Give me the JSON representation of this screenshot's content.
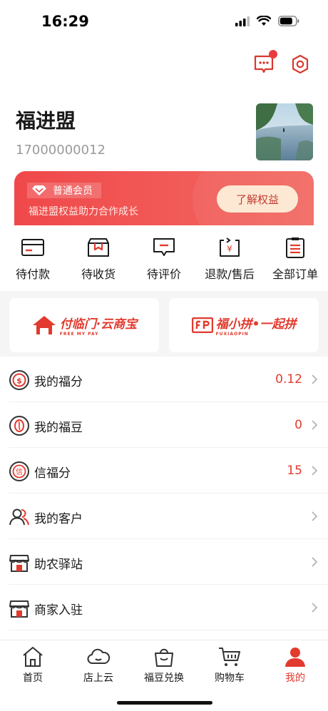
{
  "status_bar": {
    "time": "16:29"
  },
  "profile": {
    "name": "福进盟",
    "phone": "17000000012"
  },
  "member_card": {
    "level": "普通会员",
    "description": "福进盟权益助力合作成长",
    "button_label": "了解权益"
  },
  "orders": [
    {
      "label": "待付款",
      "icon": "wallet-icon"
    },
    {
      "label": "待收货",
      "icon": "package-icon"
    },
    {
      "label": "待评价",
      "icon": "comment-icon"
    },
    {
      "label": "退款/售后",
      "icon": "refund-icon"
    },
    {
      "label": "全部订单",
      "icon": "clipboard-icon"
    }
  ],
  "promos": [
    {
      "title": "付临门·云商宝",
      "subtitle": "FREE MY PAY"
    },
    {
      "title": "福小拼•一起拼",
      "subtitle": "FUXIAOPIN"
    }
  ],
  "menu": [
    {
      "label": "我的福分",
      "value": "0.12",
      "icon": "coin-icon"
    },
    {
      "label": "我的福豆",
      "value": "0",
      "icon": "bean-icon"
    },
    {
      "label": "信福分",
      "value": "15",
      "icon": "credit-icon"
    },
    {
      "label": "我的客户",
      "value": "",
      "icon": "customers-icon"
    },
    {
      "label": "助农驿站",
      "value": "",
      "icon": "store-icon"
    },
    {
      "label": "商家入驻",
      "value": "",
      "icon": "shop-icon"
    }
  ],
  "tabs": [
    {
      "label": "首页",
      "icon": "home-icon"
    },
    {
      "label": "店上云",
      "icon": "cloud-icon"
    },
    {
      "label": "福豆兑换",
      "icon": "shopping-bag-icon"
    },
    {
      "label": "购物车",
      "icon": "cart-icon"
    },
    {
      "label": "我的",
      "icon": "user-icon",
      "active": true
    }
  ],
  "colors": {
    "accent": "#e23a2e",
    "card_start": "#f0484a",
    "card_end": "#f26a63",
    "button_bg": "#fde9d3"
  }
}
